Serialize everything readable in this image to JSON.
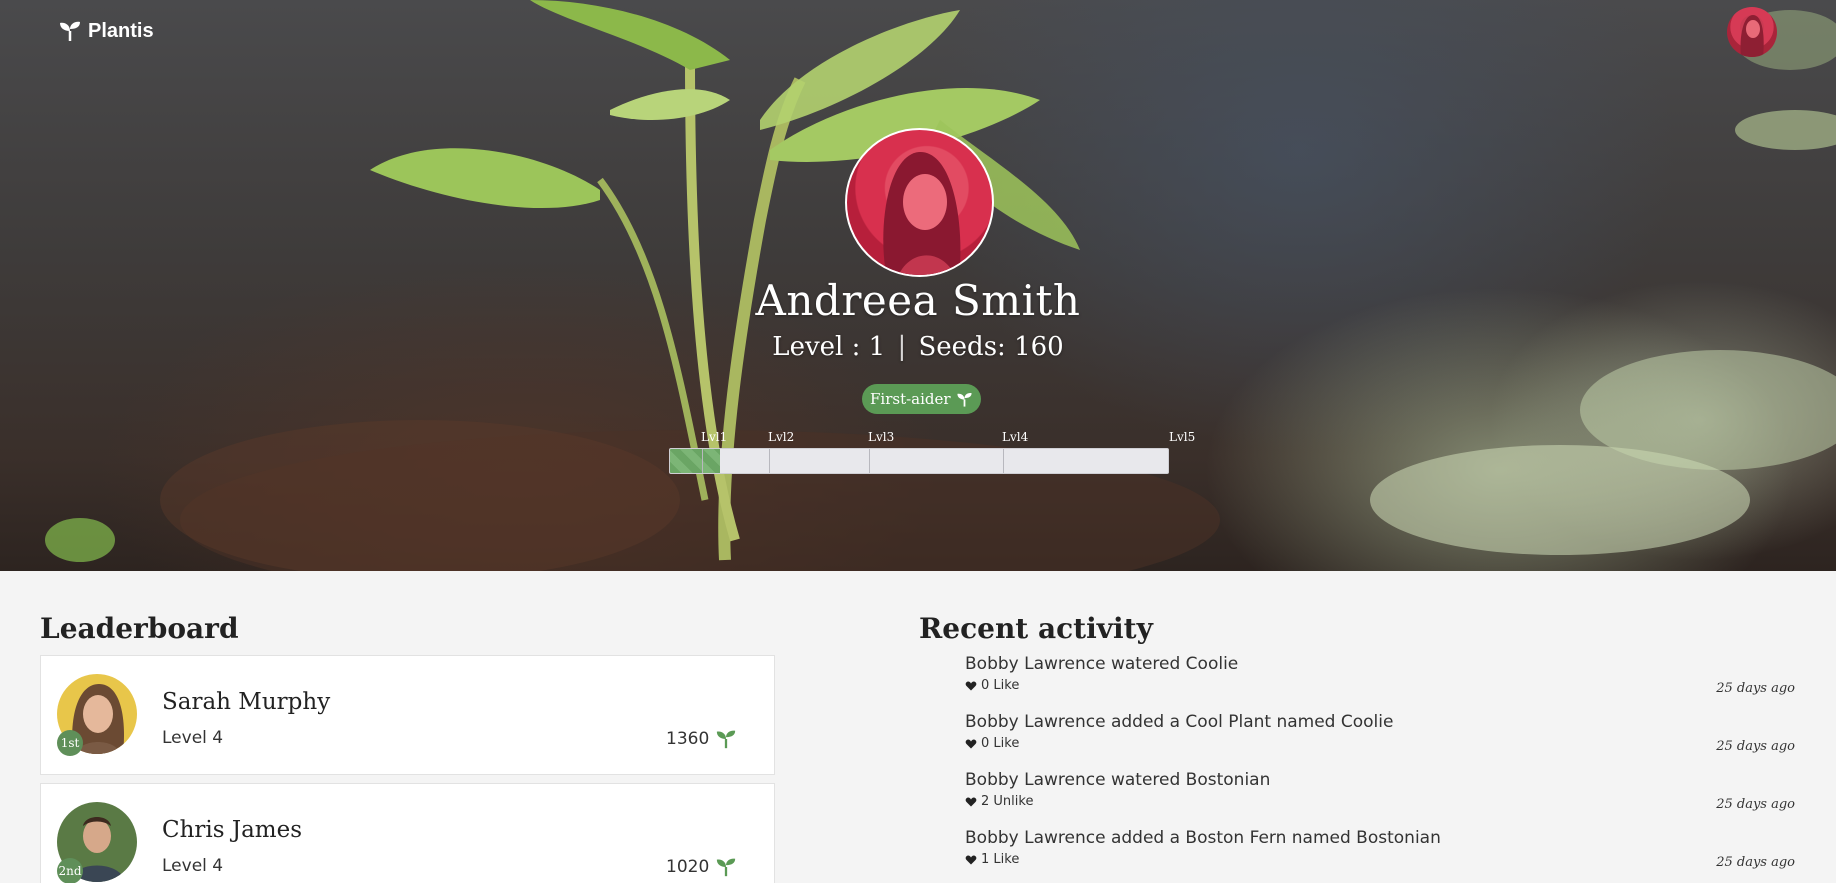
{
  "brand": {
    "name": "Plantis",
    "icon": "sprout-icon"
  },
  "profile": {
    "name": "Andreea Smith",
    "level_text": "Level : 1",
    "seeds_text": "Seeds: 160",
    "badge": "First-aider",
    "progress": {
      "levels": [
        "Lvl1",
        "Lvl2",
        "Lvl3",
        "Lvl4",
        "Lvl5"
      ],
      "fraction": 0.1
    }
  },
  "leaderboard": {
    "title": "Leaderboard",
    "entries": [
      {
        "rank": "1st",
        "name": "Sarah Murphy",
        "level": "Level 4",
        "seeds": "1360"
      },
      {
        "rank": "2nd",
        "name": "Chris James",
        "level": "Level 4",
        "seeds": "1020"
      }
    ]
  },
  "activity": {
    "title": "Recent activity",
    "items": [
      {
        "text": "Bobby Lawrence watered Coolie",
        "likes": "0 Like",
        "time": "25 days ago"
      },
      {
        "text": "Bobby Lawrence added a Cool Plant named Coolie",
        "likes": "0 Like",
        "time": "25 days ago"
      },
      {
        "text": "Bobby Lawrence watered Bostonian",
        "likes": "2 Unlike",
        "time": "25 days ago"
      },
      {
        "text": "Bobby Lawrence added a Boston Fern named Bostonian",
        "likes": "1 Like",
        "time": "25 days ago"
      }
    ]
  },
  "colors": {
    "accent": "#5b9a55",
    "background": "#f4f4f4"
  }
}
